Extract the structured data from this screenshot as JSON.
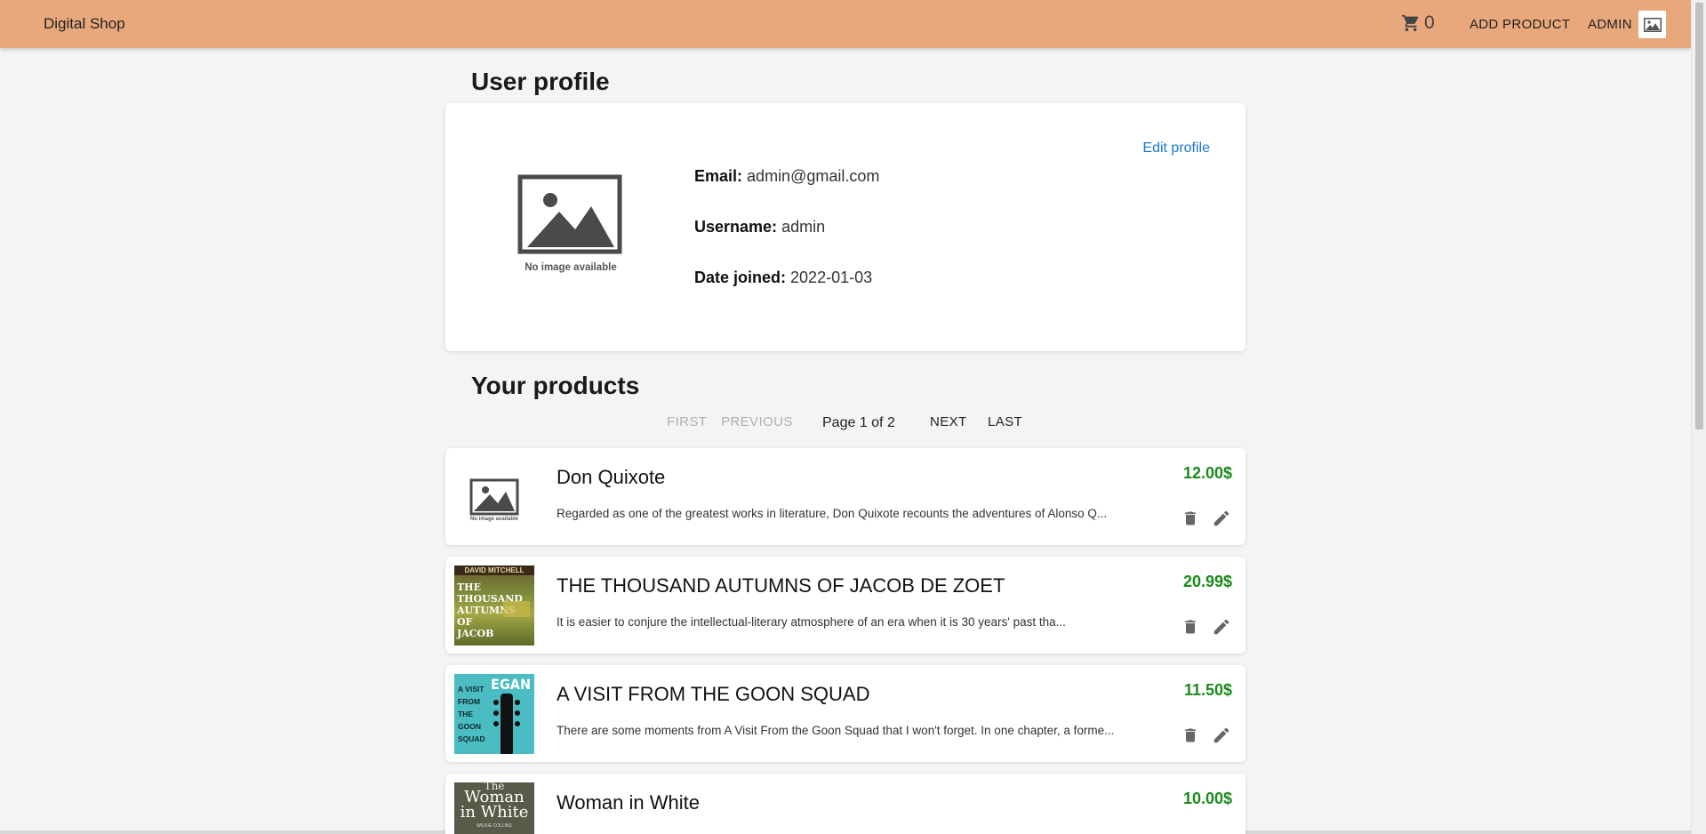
{
  "header": {
    "brand": "Digital Shop",
    "cart_count": "0",
    "add_product": "ADD PRODUCT",
    "user_menu": "ADMIN"
  },
  "profile": {
    "title": "User profile",
    "edit_link": "Edit profile",
    "no_image_text": "No image available",
    "email_label": "Email:",
    "email": "admin@gmail.com",
    "username_label": "Username:",
    "username": "admin",
    "date_label": "Date joined:",
    "date_joined": "2022-01-03"
  },
  "products_section": {
    "title": "Your products",
    "pagination": {
      "first": "FIRST",
      "previous": "PREVIOUS",
      "page_info": "Page 1 of 2",
      "next": "NEXT",
      "last": "LAST"
    },
    "items": [
      {
        "title": "Don Quixote",
        "description": "Regarded as one of the greatest works in literature, Don Quixote recounts the adventures of Alonso Q...",
        "price": "12.00$",
        "thumb_caption": "No image available"
      },
      {
        "title": "THE THOUSAND AUTUMNS OF JACOB DE ZOET",
        "description": "It is easier to conjure the intellectual-literary atmosphere of an era when it is 30 years' past tha...",
        "price": "20.99$",
        "cover_top": "DAVID MITCHELL",
        "cover_text": "THE THOUSAND AUTUMNS OF JACOB"
      },
      {
        "title": "A VISIT FROM THE GOON SQUAD",
        "description": "There are some moments from A Visit From the Goon Squad that I won't forget. In one chapter, a forme...",
        "price": "11.50$",
        "cover_author": "EGAN",
        "cover_text": "A VISIT FROM THE GOON SQUAD"
      },
      {
        "title": "Woman in White",
        "description": "",
        "price": "10.00$",
        "cover_top": "The",
        "cover_text": "Woman in White",
        "cover_author": "WILKIE COLLINS"
      }
    ]
  },
  "colors": {
    "appbar": "#e8a87c",
    "price": "#1b8a1b",
    "link": "#1976d2",
    "background": "#f4f4f4"
  }
}
